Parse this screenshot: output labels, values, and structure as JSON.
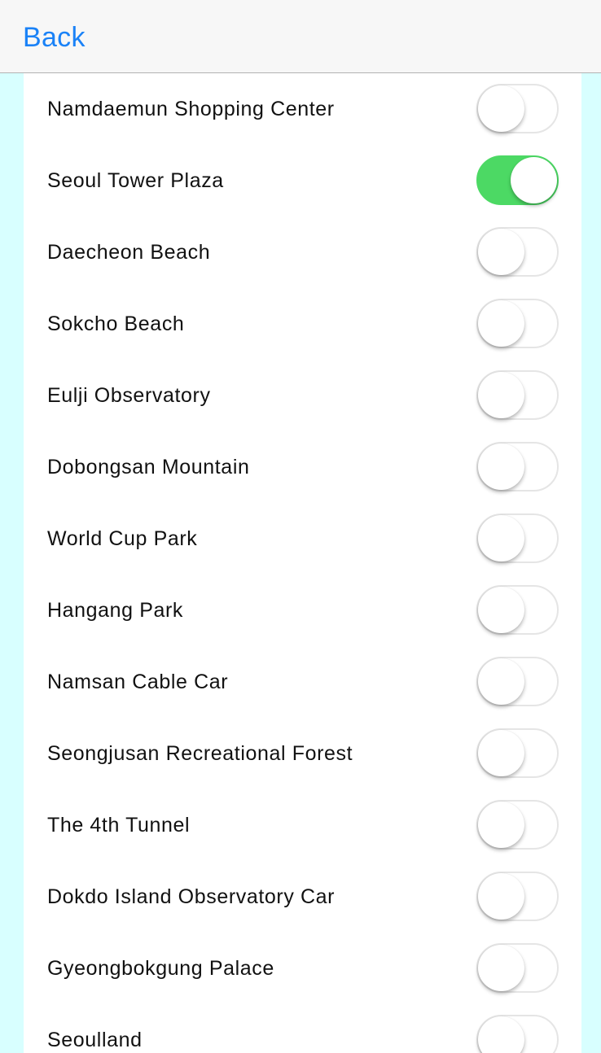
{
  "nav": {
    "back_label": "Back"
  },
  "colors": {
    "accent": "#1a82f7",
    "toggle_on": "#4cd964",
    "background": "#d8ffff"
  },
  "places": [
    {
      "label": "Namdaemun Shopping Center",
      "on": false
    },
    {
      "label": "Seoul Tower Plaza",
      "on": true
    },
    {
      "label": "Daecheon Beach",
      "on": false
    },
    {
      "label": "Sokcho Beach",
      "on": false
    },
    {
      "label": "Eulji Observatory",
      "on": false
    },
    {
      "label": "Dobongsan Mountain",
      "on": false
    },
    {
      "label": "World Cup Park",
      "on": false
    },
    {
      "label": "Hangang Park",
      "on": false
    },
    {
      "label": "Namsan Cable Car",
      "on": false
    },
    {
      "label": "Seongjusan Recreational Forest",
      "on": false
    },
    {
      "label": "The 4th Tunnel",
      "on": false
    },
    {
      "label": "Dokdo Island Observatory Car",
      "on": false
    },
    {
      "label": "Gyeongbokgung Palace",
      "on": false
    },
    {
      "label": "Seoulland",
      "on": false
    }
  ]
}
